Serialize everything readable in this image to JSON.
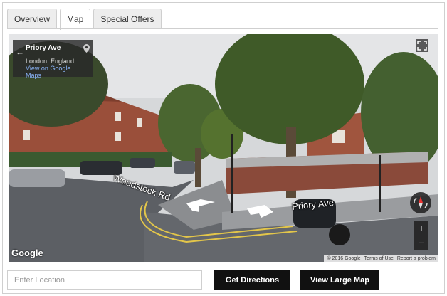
{
  "tabs": [
    {
      "label": "Overview",
      "active": false
    },
    {
      "label": "Map",
      "active": true
    },
    {
      "label": "Special Offers",
      "active": false
    }
  ],
  "streetview": {
    "location_title": "Priory Ave",
    "location_sub": "London, England",
    "view_link": "View on Google Maps",
    "road_labels": [
      "Woodstock Rd",
      "Priory Ave"
    ],
    "logo": "Google",
    "copyright": "© 2016 Google",
    "terms": "Terms of Use",
    "report": "Report a problem",
    "zoom_in": "+",
    "zoom_out": "−",
    "icons": [
      "back-arrow-icon",
      "map-pin-icon",
      "fullscreen-icon",
      "compass-icon",
      "navigation-arrow-icon"
    ]
  },
  "controls": {
    "location_placeholder": "Enter Location",
    "directions_label": "Get Directions",
    "large_map_label": "View Large Map"
  },
  "colors": {
    "button_bg": "#111111",
    "tab_bg": "#ededed",
    "border": "#cfcfcf"
  }
}
